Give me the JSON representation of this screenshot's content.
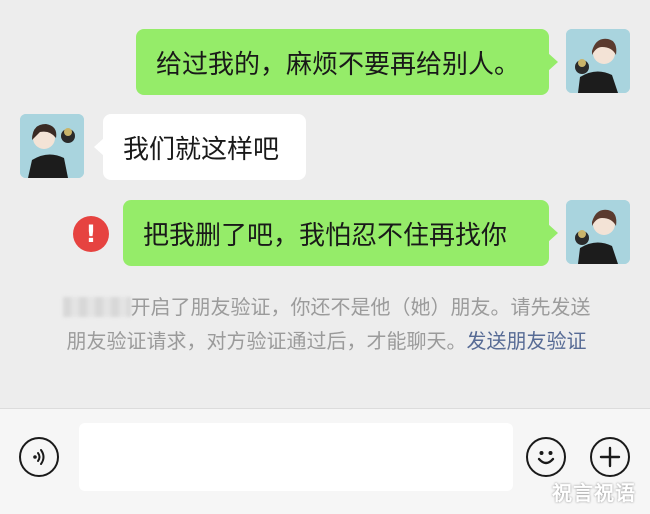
{
  "messages": [
    {
      "side": "out",
      "text": "给过我的，麻烦不要再给别人。"
    },
    {
      "side": "in",
      "text": "我们就这样吧"
    },
    {
      "side": "out",
      "text": "把我删了吧，我怕忍不住再找你",
      "failed": true
    }
  ],
  "error_icon": "!",
  "system_notice": {
    "text": "开启了朋友验证，你还不是他（她）朋友。请先发送朋友验证请求，对方验证通过后，才能聊天。",
    "link": "发送朋友验证"
  },
  "input_bar": {
    "voice_icon": "voice-icon",
    "emoji_icon": "emoji-icon",
    "plus_icon": "plus-icon",
    "input_value": ""
  },
  "watermark": "祝言祝语",
  "colors": {
    "out_bubble": "#95ec69",
    "in_bubble": "#ffffff",
    "error": "#e64340",
    "link": "#576b95",
    "background": "#ededed"
  }
}
